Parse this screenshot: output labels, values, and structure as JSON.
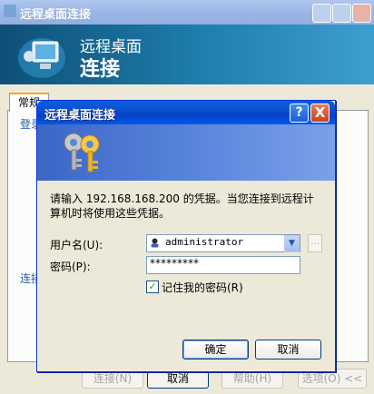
{
  "background_window": {
    "title": "远程桌面连接",
    "banner_line1": "远程桌面",
    "banner_line2": "连接",
    "tab_general": "常规",
    "panel_label_login": "登录",
    "panel_label_connect": "连接",
    "buttons": {
      "connect": "连接(N)",
      "cancel": "取消",
      "help": "帮助(H)",
      "options": "选项(O) <<"
    }
  },
  "dialog": {
    "title": "远程桌面连接",
    "help_button": "?",
    "close_button": "X",
    "message": "请输入 192.168.168.200 的凭据。当您连接到远程计算机时将使用这些凭据。",
    "username_label": "用户名(U):",
    "username_value": "administrator",
    "password_label": "密码(P):",
    "password_mask": "*********",
    "remember_label": "记住我的密码(R)",
    "remember_checked": true,
    "ok_button": "确定",
    "cancel_button": "取消",
    "browse_button": "..."
  },
  "colors": {
    "title_blue": "#0A4FD0",
    "xp_beige": "#ECE9D8",
    "banner_teal": "#1F7FAE",
    "close_red": "#C8411E"
  },
  "icons": [
    "keys-icon",
    "user-icon",
    "chevron-down-icon",
    "question-icon",
    "close-icon",
    "monitor-icon"
  ]
}
